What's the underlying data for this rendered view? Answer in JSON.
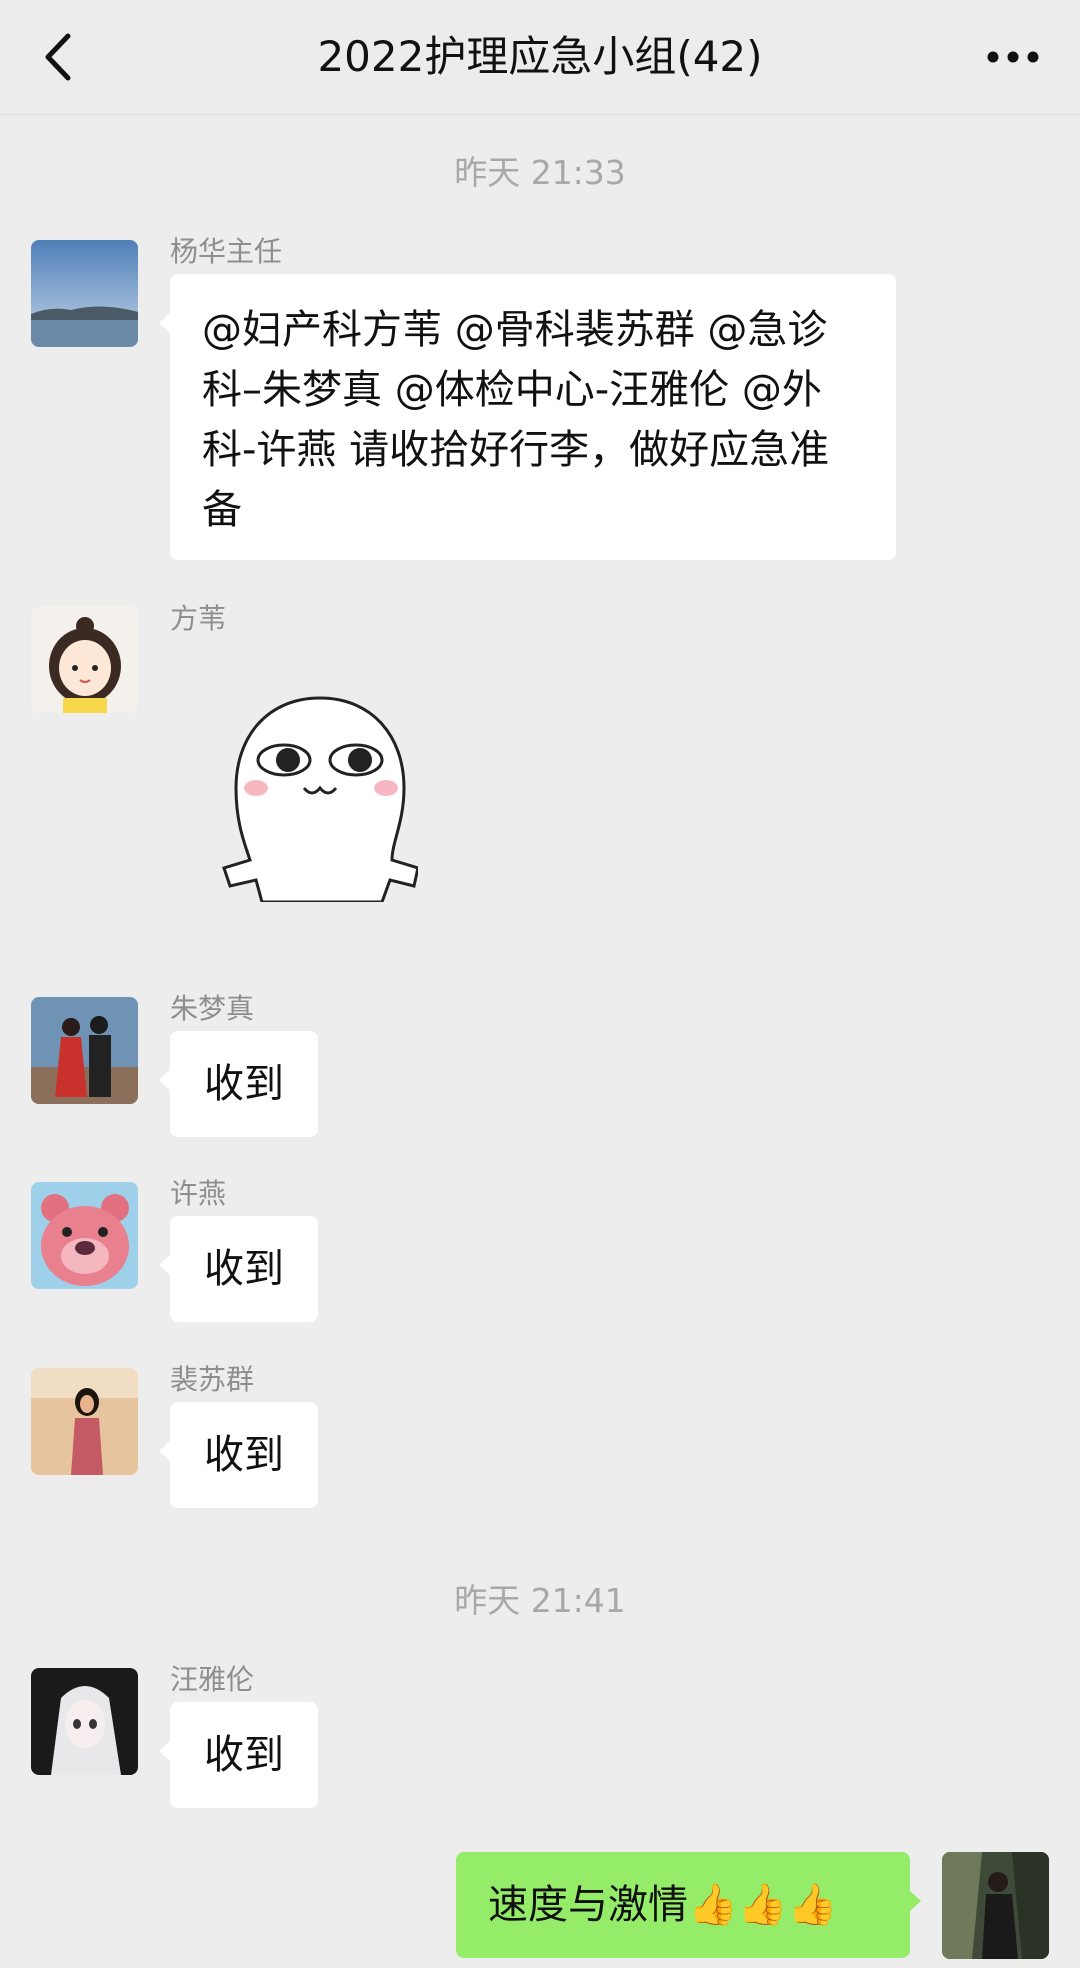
{
  "header": {
    "title": "2022护理应急小组(42)",
    "back_icon": "chevron-left-icon",
    "more_icon": "more-dots-icon"
  },
  "timestamps": [
    "昨天 21:33",
    "昨天 21:41"
  ],
  "messages": [
    {
      "sender": "杨华主任",
      "text": "@妇产科方苇 @骨科裴苏群 @急诊科–朱梦真 @体检中心-汪雅伦 @外科-许燕 请收拾好行李，做好应急准备"
    },
    {
      "sender": "方苇",
      "sticker": "white-blob-sticker"
    },
    {
      "sender": "朱梦真",
      "text": "收到"
    },
    {
      "sender": "许燕",
      "text": "收到"
    },
    {
      "sender": "裴苏群",
      "text": "收到"
    },
    {
      "sender": "汪雅伦",
      "text": "收到"
    },
    {
      "self": true,
      "text": "速度与激情👍👍👍"
    }
  ],
  "colors": {
    "background": "#ededed",
    "self_bubble": "#95ec69",
    "other_bubble": "#ffffff"
  }
}
